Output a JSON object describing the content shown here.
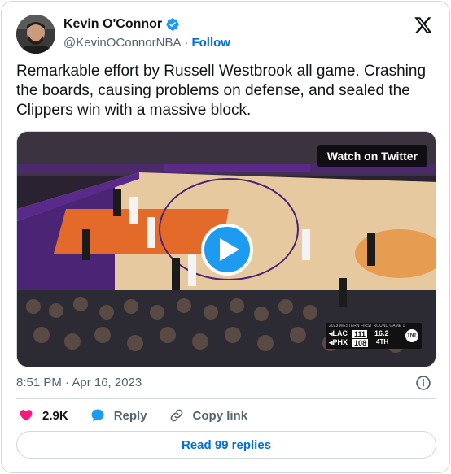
{
  "author": {
    "display_name": "Kevin O'Connor",
    "handle": "@KevinOConnorNBA",
    "separator": "·",
    "follow_label": "Follow",
    "verified_icon": "verified-badge-icon",
    "avatar": "avatar"
  },
  "tweet": {
    "text": "Remarkable effort by Russell Westbrook all game. Crashing the boards, causing problems on defense, and sealed the Clippers win with a massive block.",
    "timestamp": "8:51 PM · Apr 16, 2023"
  },
  "media": {
    "watch_label": "Watch on Twitter",
    "play_icon": "play-icon",
    "scorebug": {
      "header": "2023 WESTERN FIRST ROUND  GAME 1",
      "team1": "◂LAC",
      "score1": "111",
      "team2": "◂PHX",
      "score2": "108",
      "clock": "16.2",
      "quarter": "4TH",
      "network": "TNT"
    }
  },
  "actions": {
    "likes": "2.9K",
    "reply_label": "Reply",
    "copy_link_label": "Copy link"
  },
  "read_replies_label": "Read 99 replies",
  "colors": {
    "accent": "#1d9bf0",
    "link": "#006fd6",
    "like": "#f91880",
    "text": "#0f1419",
    "muted": "#536471",
    "border": "#cfd9de"
  }
}
